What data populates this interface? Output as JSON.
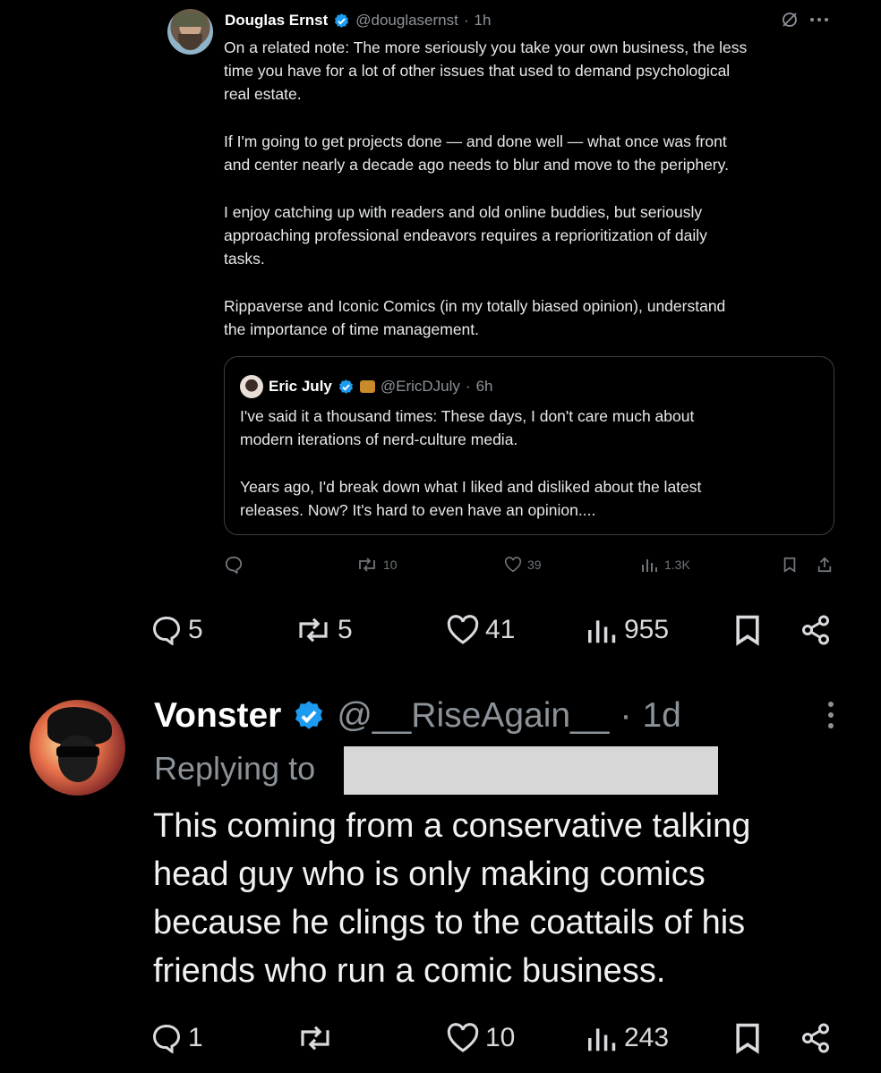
{
  "quoted_post": {
    "author": {
      "name": "Douglas Ernst",
      "handle": "@douglasernst",
      "time": "1h",
      "avatar_icon": "avatar-douglas"
    },
    "paragraphs": [
      "On a related note: The more seriously you take your own business, the less\ntime you have for a lot of other issues that used to demand psychological\nreal estate.",
      "If I'm going to get projects done — and done well — what once was front\nand center nearly a decade ago needs to blur and move to the periphery.",
      "I enjoy catching up with readers and old online buddies, but seriously\napproaching professional endeavors requires a reprioritization of daily\ntasks.",
      "Rippaverse and Iconic Comics (in my totally biased opinion), understand\nthe importance of time management."
    ],
    "inner_quote": {
      "author": {
        "name": "Eric July",
        "handle": "@EricDJuly",
        "time": "6h"
      },
      "paragraphs": [
        "I've said it a thousand times: These days, I don't care much about\nmodern iterations of nerd-culture media.",
        "Years ago, I'd break down what I liked and disliked about the latest\nreleases. Now? It's hard to even have an opinion...."
      ]
    },
    "stats": {
      "replies": "",
      "reposts": "10",
      "likes": "39",
      "views": "1.3K"
    }
  },
  "post_stats": {
    "replies": "5",
    "reposts": "5",
    "likes": "41",
    "views": "955"
  },
  "reply": {
    "author": {
      "name": "Vonster",
      "handle": "@__RiseAgain__",
      "time": "1d"
    },
    "replying_to_label": "Replying to",
    "text": "This coming from a conservative talking\nhead guy who is only making comics\nbecause he clings to the coattails of his\nfriends who run a comic business.",
    "stats": {
      "replies": "1",
      "reposts": "",
      "likes": "10",
      "views": "243"
    }
  },
  "colors": {
    "background": "#000000",
    "text": "#e7e9ea",
    "muted": "#8b9298",
    "verified": "#1d9bf0",
    "redaction": "#d7d7d7"
  }
}
